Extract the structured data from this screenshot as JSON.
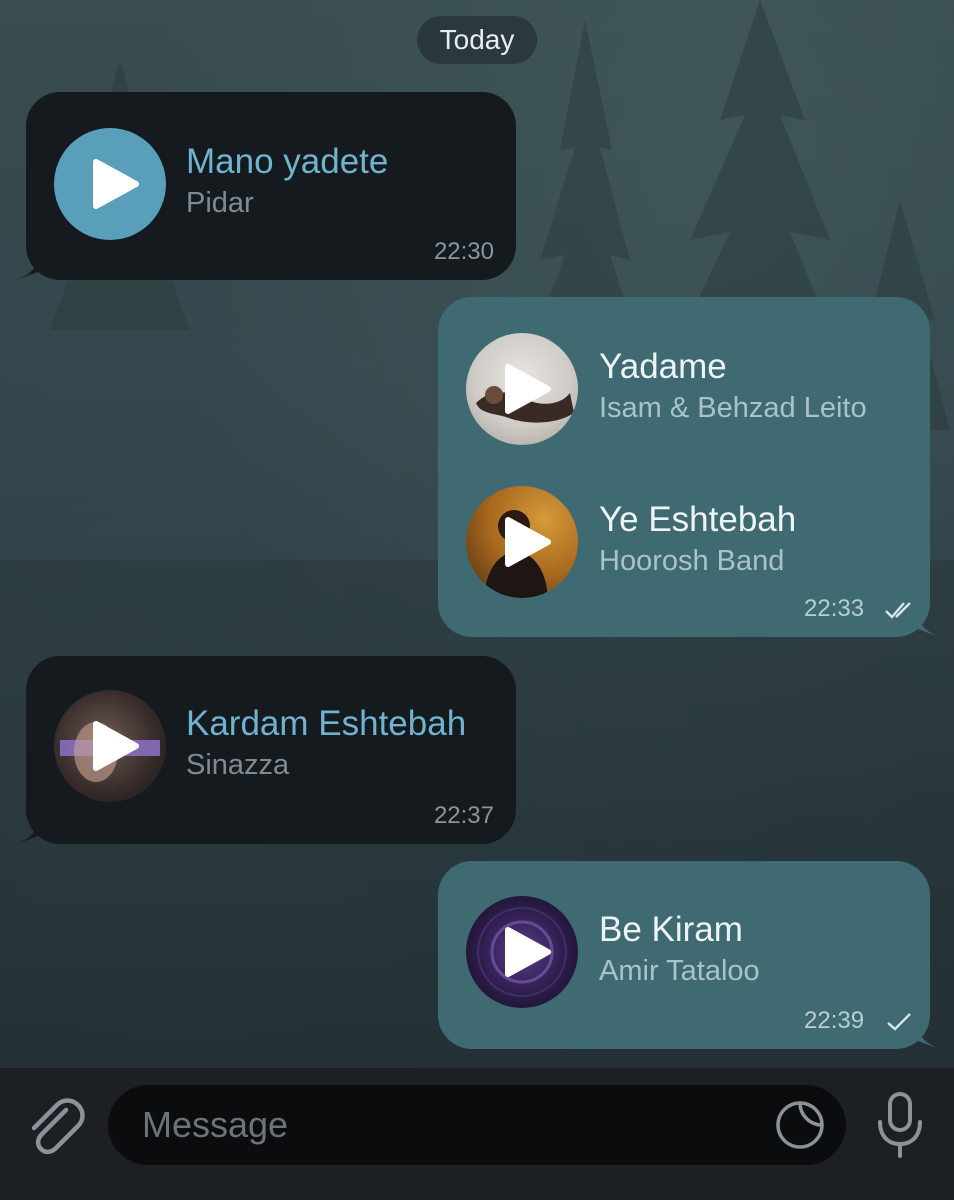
{
  "date_separator": "Today",
  "messages": [
    {
      "direction": "incoming",
      "time": "22:30",
      "tracks": [
        {
          "title": "Mano yadete",
          "artist": "Pidar",
          "cover": "plain-blue"
        }
      ]
    },
    {
      "direction": "outgoing",
      "time": "22:33",
      "status": "read",
      "tracks": [
        {
          "title": "Yadame",
          "artist": "Isam & Behzad Leito",
          "cover": "photo"
        },
        {
          "title": "Ye Eshtebah",
          "artist": "Hoorosh Band",
          "cover": "photo"
        }
      ]
    },
    {
      "direction": "incoming",
      "time": "22:37",
      "tracks": [
        {
          "title": "Kardam Eshtebah",
          "artist": "Sinazza",
          "cover": "photo"
        }
      ]
    },
    {
      "direction": "outgoing",
      "time": "22:39",
      "status": "sent",
      "tracks": [
        {
          "title": "Be Kiram",
          "artist": "Amir Tataloo",
          "cover": "photo"
        }
      ]
    }
  ],
  "composer": {
    "placeholder": "Message",
    "icons": [
      "paperclip-icon",
      "sticker-icon",
      "microphone-icon"
    ]
  },
  "colors": {
    "incoming_bubble": "#151a1f",
    "outgoing_bubble": "#3f6a72",
    "incoming_title": "#6fb3cf",
    "play_blue": "#5a9fba"
  }
}
